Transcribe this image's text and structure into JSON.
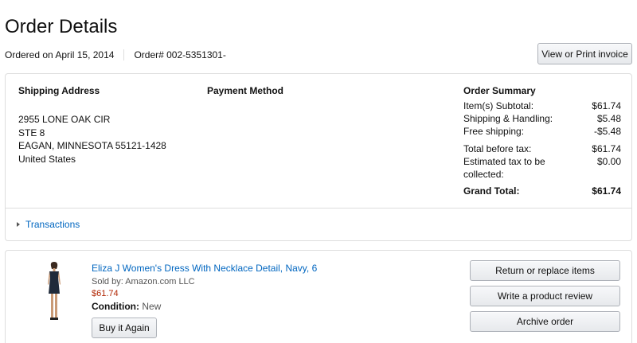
{
  "page": {
    "title": "Order Details",
    "ordered_on": "Ordered on April 15, 2014",
    "order_number": "Order# 002-5351301-"
  },
  "header": {
    "invoice_button": "View or Print invoice"
  },
  "shipping": {
    "heading": "Shipping Address",
    "lines": [
      "2955 LONE OAK CIR",
      "STE 8",
      "EAGAN, MINNESOTA 55121-1428",
      "United States"
    ]
  },
  "payment": {
    "heading": "Payment Method"
  },
  "summary": {
    "heading": "Order Summary",
    "subtotal_label": "Item(s) Subtotal:",
    "subtotal_value": "$61.74",
    "shipping_label": "Shipping & Handling:",
    "shipping_value": "$5.48",
    "free_shipping_label": "Free shipping:",
    "free_shipping_value": "-$5.48",
    "before_tax_label": "Total before tax:",
    "before_tax_value": "$61.74",
    "tax_label": "Estimated tax to be collected:",
    "tax_value": "$0.00",
    "grand_label": "Grand Total:",
    "grand_value": "$61.74"
  },
  "transactions": {
    "label": "Transactions"
  },
  "item": {
    "title": "Eliza J Women's Dress With Necklace Detail, Navy, 6",
    "seller": "Sold by: Amazon.com LLC",
    "price": "$61.74",
    "condition_label": "Condition:",
    "condition_value": "New",
    "buy_again": "Buy it Again",
    "image_icon": "product-dress-image"
  },
  "actions": {
    "return": "Return or replace items",
    "review": "Write a product review",
    "archive": "Archive order"
  },
  "colors": {
    "link": "#0066c0",
    "price": "#b12704",
    "border": "#dddddd"
  }
}
